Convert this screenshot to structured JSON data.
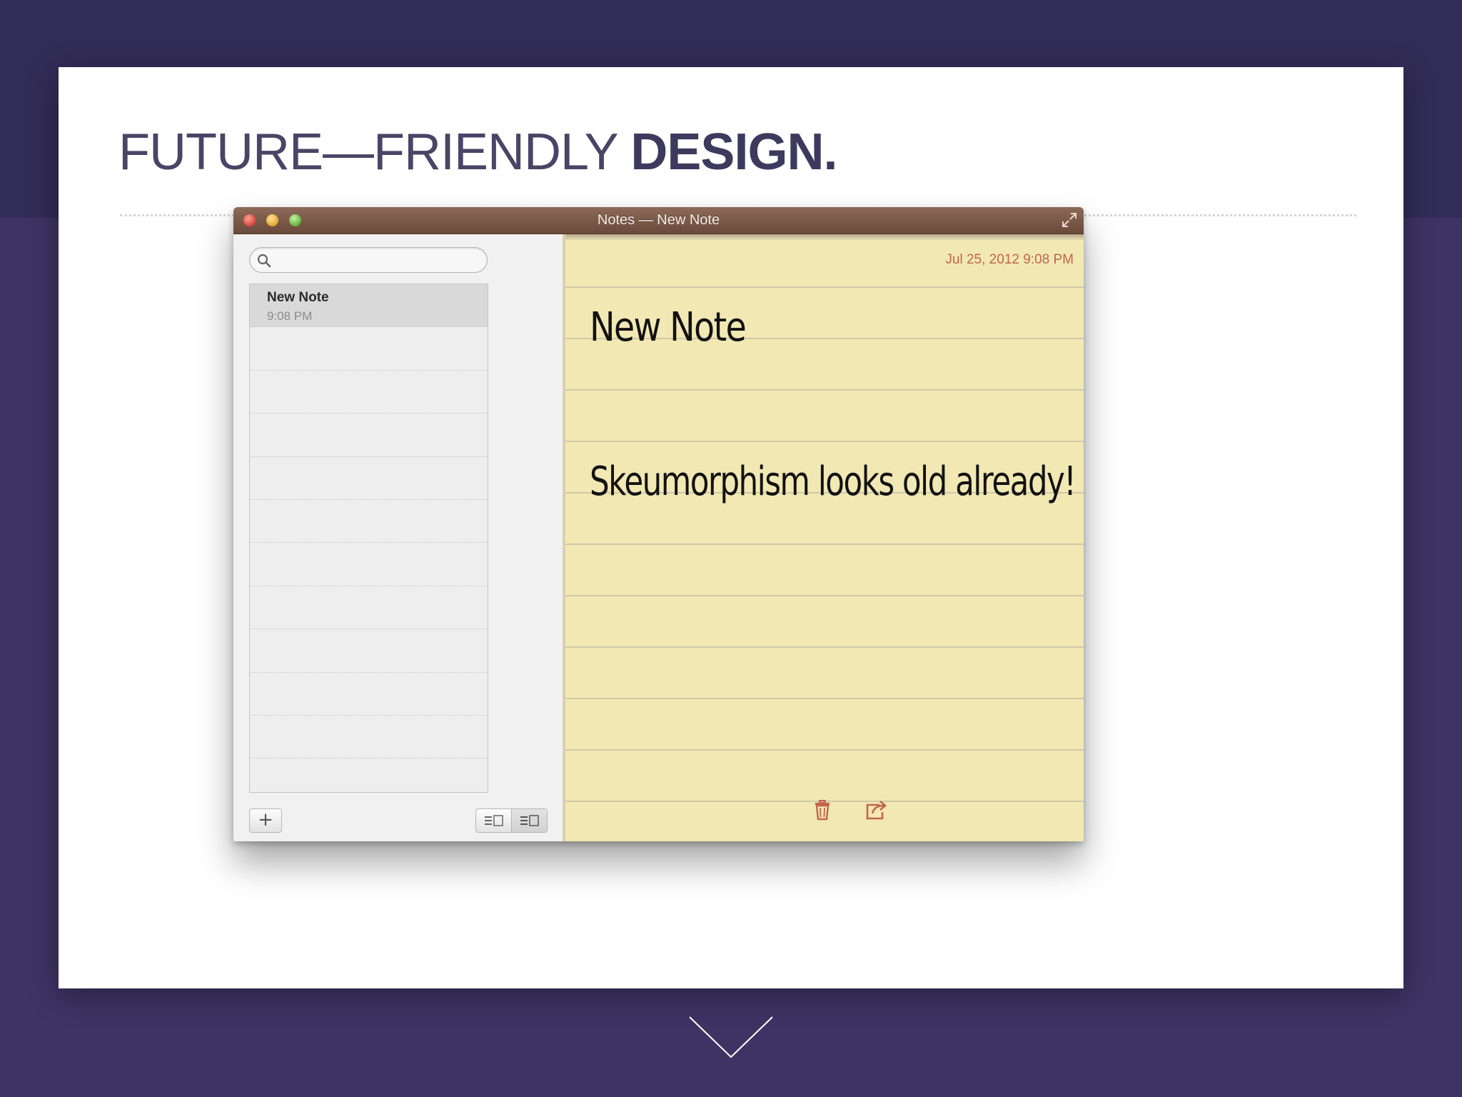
{
  "slide": {
    "title_thin": "FUTURE—FRIENDLY ",
    "title_bold": "DESIGN."
  },
  "window": {
    "title": "Notes — New Note"
  },
  "sidebar": {
    "search": {
      "placeholder": "",
      "icon": "search-icon"
    },
    "notes": [
      {
        "title": "New Note",
        "time": "9:08 PM"
      }
    ],
    "add_label": "+"
  },
  "note": {
    "date": "Jul 25, 2012 9:08 PM",
    "heading": "New Note",
    "body": "Skeumorphism looks old already!"
  },
  "colors": {
    "background": "#3d3464",
    "slide": "#ffffff",
    "titlebar": "#7a5847",
    "paper": "#f2e8b4",
    "accent": "#c06650"
  }
}
